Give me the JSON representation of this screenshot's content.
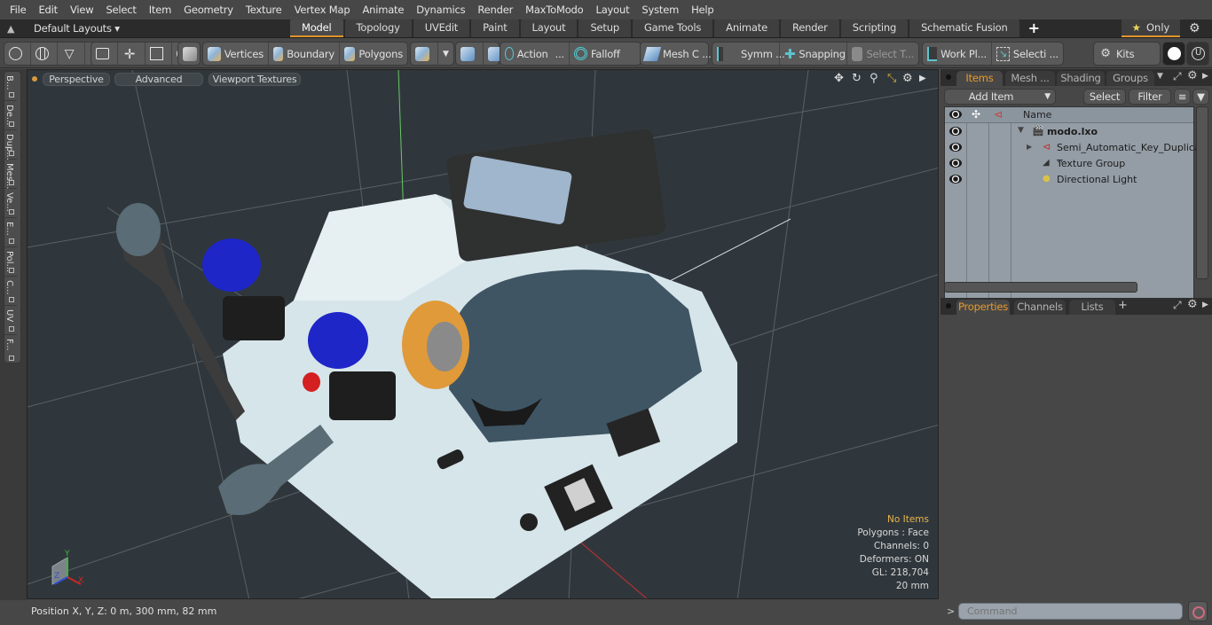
{
  "menubar": {
    "items": [
      "File",
      "Edit",
      "View",
      "Select",
      "Item",
      "Geometry",
      "Texture",
      "Vertex Map",
      "Animate",
      "Dynamics",
      "Render",
      "MaxToModo",
      "Layout",
      "System",
      "Help"
    ]
  },
  "tabbar": {
    "layouts_label": "Default Layouts ▾",
    "tabs": [
      "Model",
      "Topology",
      "UVEdit",
      "Paint",
      "Layout",
      "Setup",
      "Game Tools",
      "Animate",
      "Render",
      "Scripting",
      "Schematic Fusion"
    ],
    "active_tab": "Model",
    "add_tab": "+",
    "only_label": "Only",
    "accent": "#e0952c"
  },
  "toolbar": {
    "vertices": "Vertices",
    "boundary": "Boundary",
    "polygons": "Polygons",
    "action": "Action",
    "action_more": "...",
    "falloff": "Falloff",
    "mesh_c": "Mesh C ...",
    "symm": "Symm ...",
    "snapping": "Snapping",
    "select_t": "Select T...",
    "work_pl": "Work Pl...",
    "selecti": "Selecti ...",
    "kits": "Kits"
  },
  "left_strip": {
    "tabs": [
      "B...",
      "De...",
      "Dup...",
      "Mes...",
      "Ve...",
      "E...",
      "Pol...",
      "C...",
      "UV",
      "F..."
    ]
  },
  "viewport": {
    "view_mode": "Perspective",
    "shading": "Advanced",
    "textures": "Viewport Textures",
    "info": {
      "selection": "No Items",
      "polygons": "Polygons : Face",
      "channels": "Channels: 0",
      "deformers": "Deformers: ON",
      "gl": "GL: 218,704",
      "grid": "20 mm"
    },
    "axes": {
      "x": "X",
      "y": "Y",
      "z": "Z"
    }
  },
  "status": {
    "position": "Position X, Y, Z:   0 m, 300 mm, 82 mm"
  },
  "items_panel": {
    "tabs": [
      "Items",
      "Mesh ...",
      "Shading",
      "Groups"
    ],
    "active_tab": "Items",
    "add_item": "Add Item",
    "select": "Select",
    "filter": "Filter",
    "column_name": "Name",
    "rows": [
      {
        "name": "modo.lxo",
        "level": 0,
        "bold": true
      },
      {
        "name": "Semi_Automatic_Key_Duplica ...",
        "level": 1
      },
      {
        "name": "Texture Group",
        "level": 1
      },
      {
        "name": "Directional Light",
        "level": 1
      }
    ]
  },
  "properties_panel": {
    "tabs": [
      "Properties",
      "Channels",
      "Lists"
    ],
    "active_tab": "Properties",
    "add_tab": "+"
  },
  "command": {
    "placeholder": "Command",
    "prompt": ">"
  }
}
